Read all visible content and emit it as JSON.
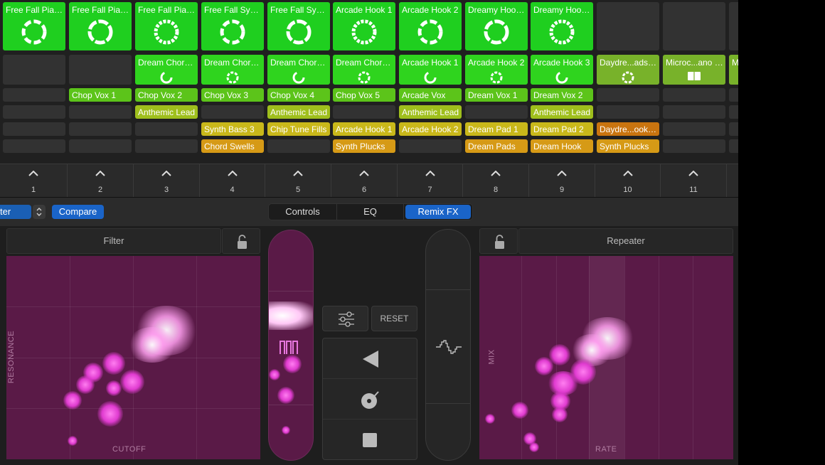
{
  "clip_rows": [
    [
      "Free Fall Piano",
      "Free Fall Piano",
      "Free Fall Piano",
      "Free Fall Synth",
      "Free Fall Synth",
      "Arcade Hook 1",
      "Arcade Hook 2",
      "Dreamy Hook 1",
      "Dreamy Hook 2",
      "",
      ""
    ],
    [
      "",
      "",
      "Dream Chord 1",
      "Dream Chord 2",
      "Dream Chord 3",
      "Dream Chord 4",
      "Arcade Hook 1",
      "Arcade Hook 2",
      "Arcade Hook 3",
      "Daydre...ads 01",
      "Microc...ano 03"
    ],
    [
      "",
      "Chop Vox 1",
      "Chop Vox 2",
      "Chop Vox 3",
      "Chop Vox 4",
      "Chop Vox 5",
      "Arcade Vox",
      "Dream Vox 1",
      "Dream Vox 2",
      "",
      ""
    ],
    [
      "",
      "",
      "Anthemic Lead",
      "",
      "Anthemic Lead",
      "",
      "Anthemic Lead",
      "",
      "Anthemic Lead",
      "",
      ""
    ],
    [
      "",
      "",
      "",
      "Synth Bass 3",
      "Chip Tune Fills",
      "Arcade Hook 1",
      "Arcade Hook 2",
      "Dream Pad 1",
      "Dream Pad 2",
      "Daydre...ook 01",
      ""
    ],
    [
      "",
      "",
      "",
      "Chord Swells",
      "",
      "Synth Plucks",
      "",
      "Dream Pads",
      "Dream Hook",
      "Synth Plucks",
      ""
    ]
  ],
  "extra_clip_label": "M",
  "tracks": [
    "1",
    "2",
    "3",
    "4",
    "5",
    "6",
    "7",
    "8",
    "9",
    "10",
    "11"
  ],
  "toolbar": {
    "preset_label": "ter",
    "compare_label": "Compare",
    "tabs": {
      "controls": "Controls",
      "eq": "EQ",
      "remix_fx": "Remix FX"
    },
    "active_tab": "Remix FX"
  },
  "fx": {
    "left_title": "Filter",
    "left_x_axis": "CUTOFF",
    "left_y_axis": "RESONANCE",
    "right_title": "Repeater",
    "right_x_axis": "RATE",
    "right_y_axis": "MIX",
    "reset_label": "RESET"
  },
  "colors": {
    "accent": "#1a64c8",
    "pad": "#5a1a47",
    "clip_green": "#1fcf1f",
    "clip_yellow": "#c9b81a",
    "clip_orange": "#d69a16"
  }
}
